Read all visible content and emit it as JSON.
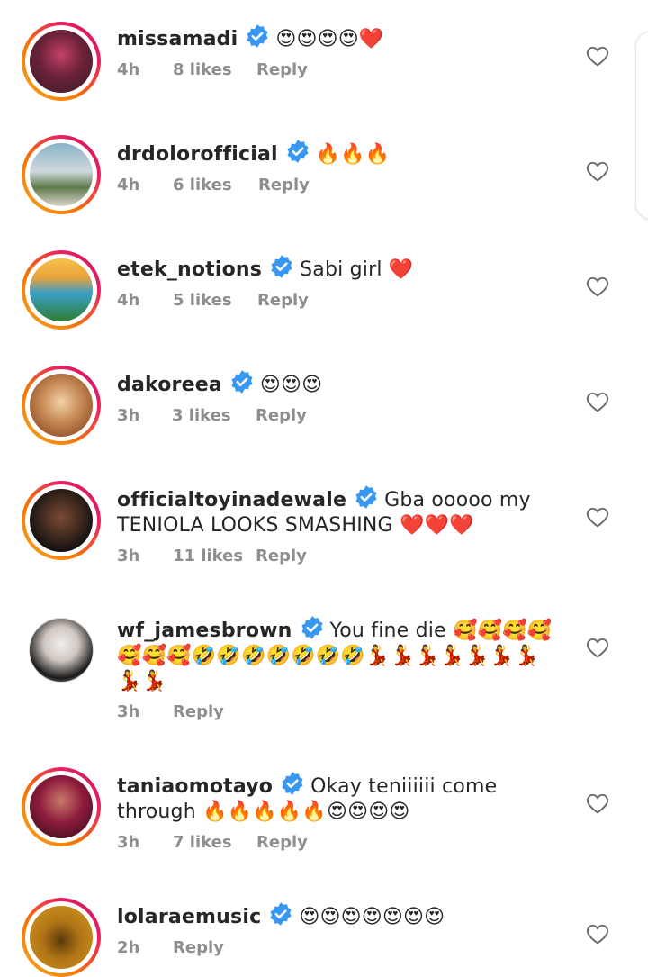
{
  "comments": [
    {
      "username": "missamadi",
      "text": "😍😍😍😍❤️",
      "time": "4h",
      "likes": "8 likes",
      "reply": "Reply",
      "avatar_colors": [
        "#3a1c28",
        "#c2416a"
      ],
      "story_ring": true
    },
    {
      "username": "drdolorofficial",
      "text": "🔥🔥🔥",
      "time": "4h",
      "likes": "6 likes",
      "reply": "Reply",
      "avatar_colors": [
        "#8ab2c9",
        "#d8d4c8"
      ],
      "story_ring": true
    },
    {
      "username": "etek_notions",
      "text": "Sabi girl ❤️",
      "time": "4h",
      "likes": "5 likes",
      "reply": "Reply",
      "avatar_colors": [
        "#3aa0c8",
        "#2e7d32"
      ],
      "story_ring": true
    },
    {
      "username": "dakoreea",
      "text": "😍😍😍",
      "time": "3h",
      "likes": "3 likes",
      "reply": "Reply",
      "avatar_colors": [
        "#f2d2a6",
        "#9c5b2e"
      ],
      "story_ring": true
    },
    {
      "username": "officialtoyinadewale",
      "text": "Gba ooooo my TENIOLA LOOKS SMASHING ❤️❤️❤️",
      "time": "3h",
      "likes": "11 likes",
      "reply": "Reply",
      "avatar_colors": [
        "#0f0f0f",
        "#4a2f22"
      ],
      "story_ring": true
    },
    {
      "username": "wf_jamesbrown",
      "text": "You fine die 🥰🥰🥰🥰🥰🥰🥰🤣🤣🤣🤣🤣🤣🤣💃💃💃💃💃💃💃💃💃",
      "time": "3h",
      "likes": "",
      "reply": "Reply",
      "avatar_colors": [
        "#f0f0f0",
        "#1a1a1a"
      ],
      "story_ring": false
    },
    {
      "username": "taniaomotayo",
      "text": "Okay teniiiiii come through 🔥🔥🔥🔥🔥😍😍😍😍",
      "time": "3h",
      "likes": "7 likes",
      "reply": "Reply",
      "avatar_colors": [
        "#2b0f1a",
        "#8e1b3c"
      ],
      "story_ring": true
    },
    {
      "username": "lolaraemusic",
      "text": "😍😍😍😍😍😍😍",
      "time": "2h",
      "likes": "",
      "reply": "Reply",
      "avatar_colors": [
        "#d49a1e",
        "#5a3a0a"
      ],
      "story_ring": true
    }
  ],
  "colors": {
    "verified": "#3897f0",
    "meta": "#8e8e8e",
    "text": "#262626"
  },
  "icons": {
    "verified": "verified-badge-icon",
    "like": "heart-outline-icon"
  }
}
